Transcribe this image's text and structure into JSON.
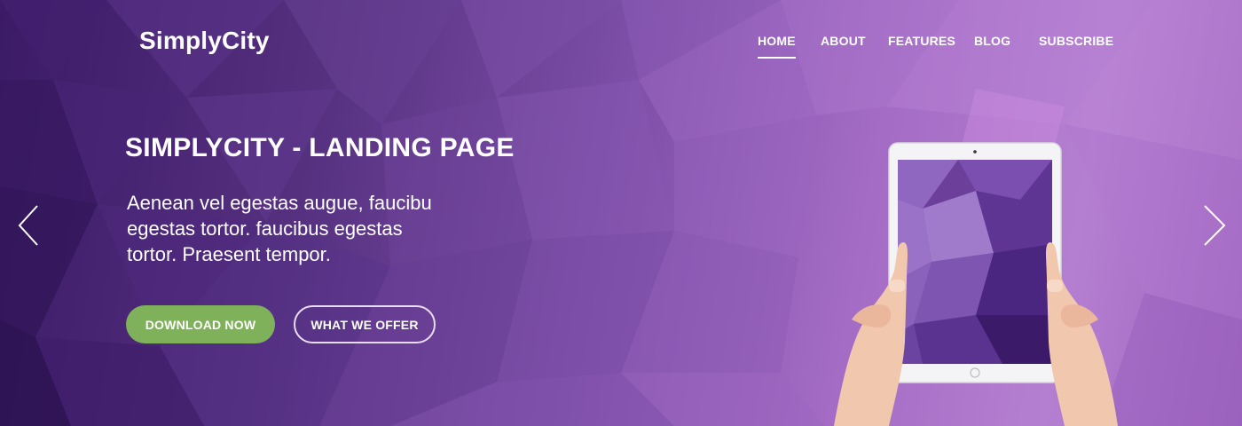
{
  "brand": {
    "name": "SimplyCity"
  },
  "nav": {
    "items": [
      {
        "label": "HOME",
        "active": true
      },
      {
        "label": "ABOUT",
        "active": false
      },
      {
        "label": "FEATURES",
        "active": false
      },
      {
        "label": "BLOG",
        "active": false
      },
      {
        "label": "SUBSCRIBE",
        "active": false
      }
    ]
  },
  "hero": {
    "title": "SIMPLYCITY - LANDING PAGE",
    "lead_lines": [
      "Aenean vel egestas augue, faucibu",
      "egestas tortor. faucibus egestas",
      "tortor. Praesent tempor."
    ],
    "primary_button": "DOWNLOAD NOW",
    "secondary_button": "WHAT WE OFFER"
  },
  "carousel": {
    "prev_icon": "chevron-left-icon",
    "next_icon": "chevron-right-icon"
  },
  "colors": {
    "primary_button": "#7fb15a",
    "background_dark": "#3b1a66",
    "background_light": "#b57fd1"
  }
}
